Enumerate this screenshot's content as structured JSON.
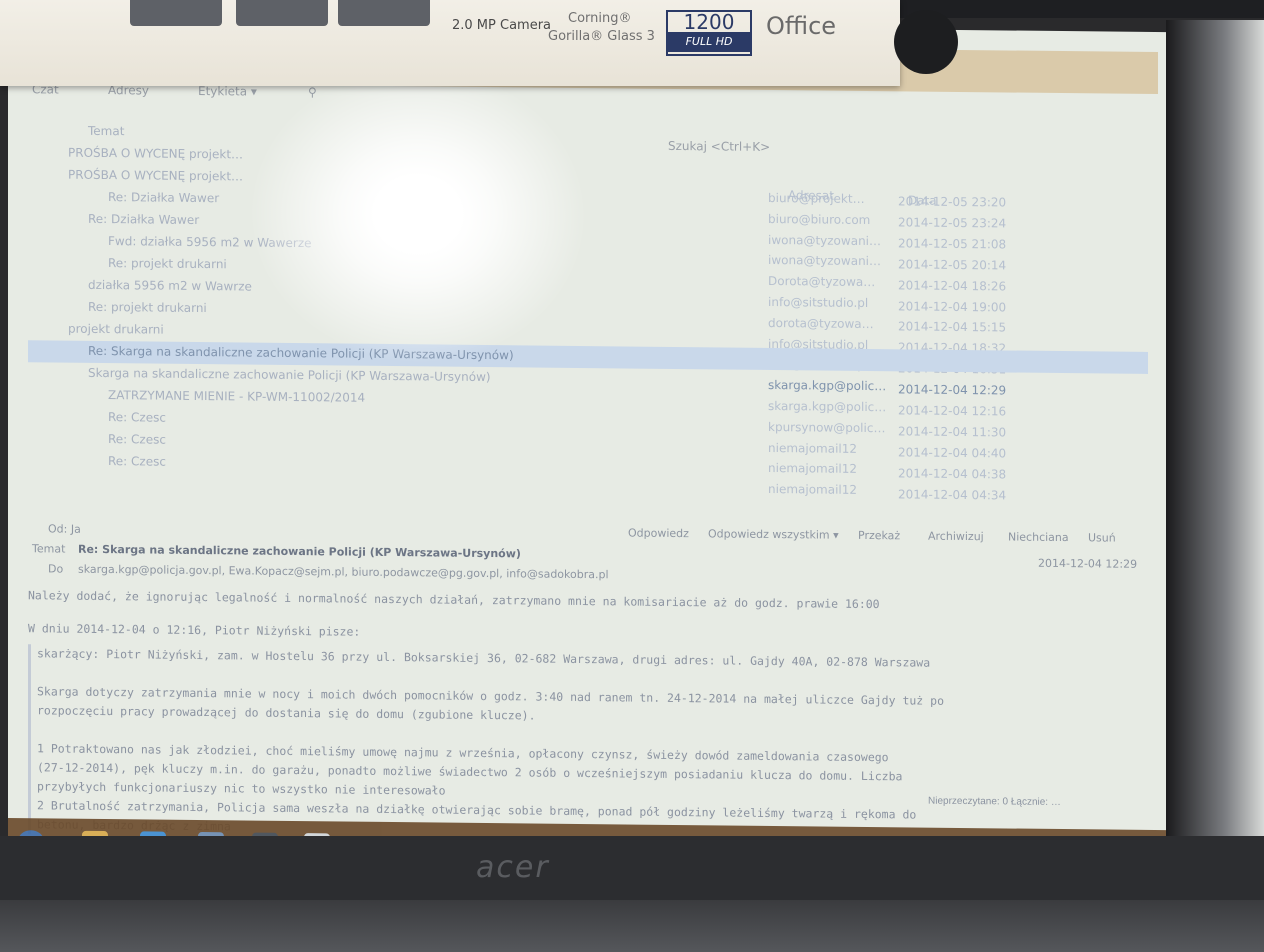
{
  "sticker": {
    "camera": "2.0 MP Camera",
    "glass_line1": "Corning®",
    "glass_line2": "Gorilla® Glass 3",
    "hd_number": "1200",
    "hd_label": "FULL HD",
    "office": "Office"
  },
  "toolbar": {
    "get": "Czat",
    "address_book": "Adresy",
    "tag": "Etykieta ▾",
    "filter_placeholder": "Szukaj <Ctrl+K>"
  },
  "columns": {
    "subject": "Temat",
    "author": "Adresat",
    "date": "Data"
  },
  "messages": [
    {
      "subject": "PROŚBA O WYCENĘ projekt…",
      "author": "biuro@projekt…",
      "date": "2014-12-05 23:20"
    },
    {
      "subject": "PROŚBA O WYCENĘ projekt…",
      "author": "biuro@biuro.com",
      "date": "2014-12-05 23:24"
    },
    {
      "subject": "Re: Działka Wawer",
      "author": "iwona@tyzowani…",
      "date": "2014-12-05 21:08"
    },
    {
      "subject": "Re: Działka Wawer",
      "author": "iwona@tyzowani…",
      "date": "2014-12-05 20:14"
    },
    {
      "subject": "Fwd: działka 5956 m2 w Wawerze",
      "author": "Dorota@tyzowa…",
      "date": "2014-12-04 18:26"
    },
    {
      "subject": "Re: projekt drukarni",
      "author": "info@sitstudio.pl",
      "date": "2014-12-04 19:00"
    },
    {
      "subject": "działka 5956 m2 w Wawrze",
      "author": "dorota@tyzowa…",
      "date": "2014-12-04 15:15"
    },
    {
      "subject": "Re: projekt drukarni",
      "author": "info@sitstudio.pl",
      "date": "2014-12-04 18:32"
    },
    {
      "subject": "projekt drukarni",
      "author": "info@sitstudio.pl",
      "date": "2014-12-04 16:51"
    },
    {
      "subject": "Re: Skarga na skandaliczne zachowanie Policji (KP Warszawa-Ursynów)",
      "author": "skarga.kgp@polic…",
      "date": "2014-12-04 12:29"
    },
    {
      "subject": "Skarga na skandaliczne zachowanie Policji (KP Warszawa-Ursynów)",
      "author": "skarga.kgp@polic…",
      "date": "2014-12-04 12:16"
    },
    {
      "subject": "ZATRZYMANE MIENIE - KP-WM-11002/2014",
      "author": "kpursynow@polic…",
      "date": "2014-12-04 11:30"
    },
    {
      "subject": "Re: Czesc",
      "author": "niemajomail12",
      "date": "2014-12-04 04:40"
    },
    {
      "subject": "Re: Czesc",
      "author": "niemajomail12",
      "date": "2014-12-04 04:38"
    },
    {
      "subject": "Re: Czesc",
      "author": "niemajomail12",
      "date": "2014-12-04 04:34"
    }
  ],
  "header": {
    "from": "Od: Ja",
    "reply": "Odpowiedz",
    "reply_all": "Odpowiedz wszystkim ▾",
    "forward": "Przekaż",
    "archive": "Archiwizuj",
    "junk": "Niechciana",
    "delete": "Usuń",
    "subject_label": "Temat",
    "subject": "Re: Skarga na skandaliczne zachowanie Policji (KP Warszawa-Ursynów)",
    "date": "2014-12-04 12:29",
    "to_label": "Do",
    "to": "skarga.kgp@policja.gov.pl, Ewa.Kopacz@sejm.pl, biuro.podawcze@pg.gov.pl, info@sadokobra.pl"
  },
  "body": [
    "Należy dodać, że ignorując legalność i normalność naszych działań, zatrzymano mnie na komisariacie aż do godz. prawie 16:00"
  ],
  "quote_header": "W dniu 2014-12-04 o 12:16, Piotr Niżyński pisze:",
  "quote": [
    "skarżący: Piotr Niżyński, zam. w Hostelu 36 przy ul. Boksarskiej 36, 02-682 Warszawa, drugi adres: ul. Gajdy 40A, 02-878 Warszawa",
    "",
    "Skarga dotyczy zatrzymania mnie w nocy i moich dwóch pomocników o godz. 3:40 nad ranem tn. 24-12-2014 na małej uliczce Gajdy tuż po",
    "rozpoczęciu pracy prowadzącej do dostania się do domu (zgubione klucze).",
    "",
    "1 Potraktowano nas jak złodziei, choć mieliśmy umowę najmu z września, opłacony czynsz, świeży dowód zameldowania czasowego",
    "(27-12-2014), pęk kluczy m.in. do garażu, ponadto możliwe świadectwo 2 osób o wcześniejszym posiadaniu klucza do domu. Liczba",
    "przybyłych funkcjonariuszy nic to wszystko nie interesowało",
    "2 Brutalność zatrzymania, Policja sama weszła na działkę otwierając sobie bramę, ponad pół godziny leżeliśmy twarzą i rękoma do",
    "betonu, bardzo drżąc z zimna"
  ],
  "status": "Nieprzeczytane: 0   Łącznie: …",
  "brand": "acer"
}
